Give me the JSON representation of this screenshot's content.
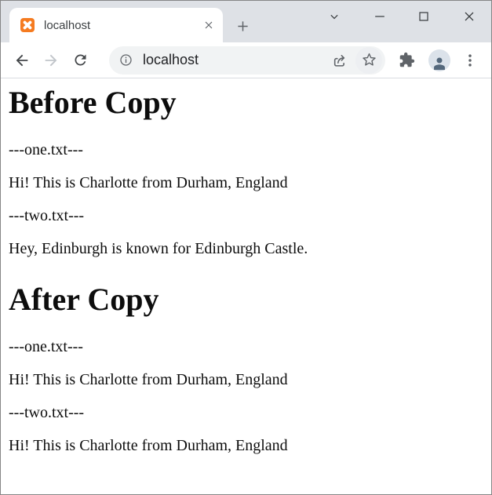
{
  "browser": {
    "tab": {
      "title": "localhost",
      "favicon": "xampp-icon"
    },
    "window_controls": {
      "chevron": "tab-search",
      "minimize": "minimize",
      "maximize": "maximize",
      "close": "close"
    },
    "address_bar": {
      "url": "localhost",
      "site_info_icon": "info-icon"
    },
    "toolbar_icons": [
      "back-icon",
      "forward-icon",
      "reload-icon",
      "share-icon",
      "star-icon",
      "extensions-icon",
      "profile-avatar",
      "kebab-menu-icon"
    ],
    "colors": {
      "tabstrip_bg": "#dee1e6",
      "omnibox_bg": "#f1f3f4",
      "favicon_orange": "#f57b20",
      "icon_gray": "#5f6368",
      "disabled_icon_gray": "#c1c5ca",
      "avatar_bg": "#dbe2ea",
      "avatar_person": "#54687c"
    }
  },
  "page": {
    "sections": [
      {
        "heading": "Before Copy",
        "lines": [
          "---one.txt---",
          "Hi! This is Charlotte from Durham, England",
          "---two.txt---",
          "Hey, Edinburgh is known for Edinburgh Castle."
        ]
      },
      {
        "heading": "After Copy",
        "lines": [
          "---one.txt---",
          "Hi! This is Charlotte from Durham, England",
          "---two.txt---",
          "Hi! This is Charlotte from Durham, England"
        ]
      }
    ]
  }
}
